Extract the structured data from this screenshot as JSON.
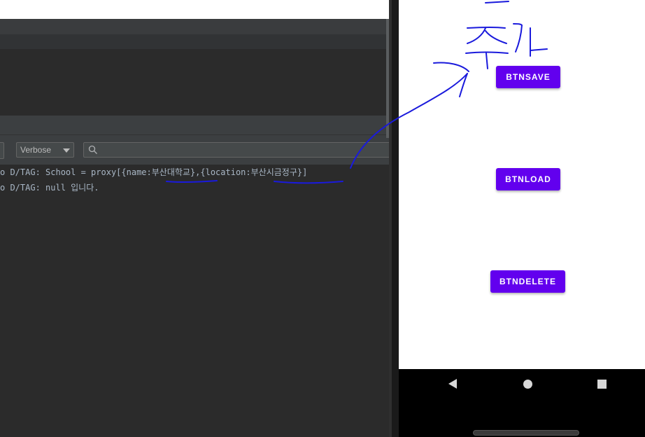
{
  "logcat": {
    "level_select": "Verbose",
    "search_placeholder": "",
    "lines": [
      "o D/TAG: School = proxy[{name:부산대학교},{location:부산시금정구}]",
      "o D/TAG: null 입니다."
    ]
  },
  "app": {
    "buttons": {
      "save": "BTNSAVE",
      "load": "BTNLOAD",
      "delete": "BTNDELETE"
    }
  },
  "navigation": {
    "icons": [
      "back-icon",
      "home-icon",
      "recents-icon"
    ]
  },
  "colors": {
    "button": "#6200ee",
    "annotation_ink": "#1a1adc",
    "ide_background": "#2b2b2b"
  }
}
